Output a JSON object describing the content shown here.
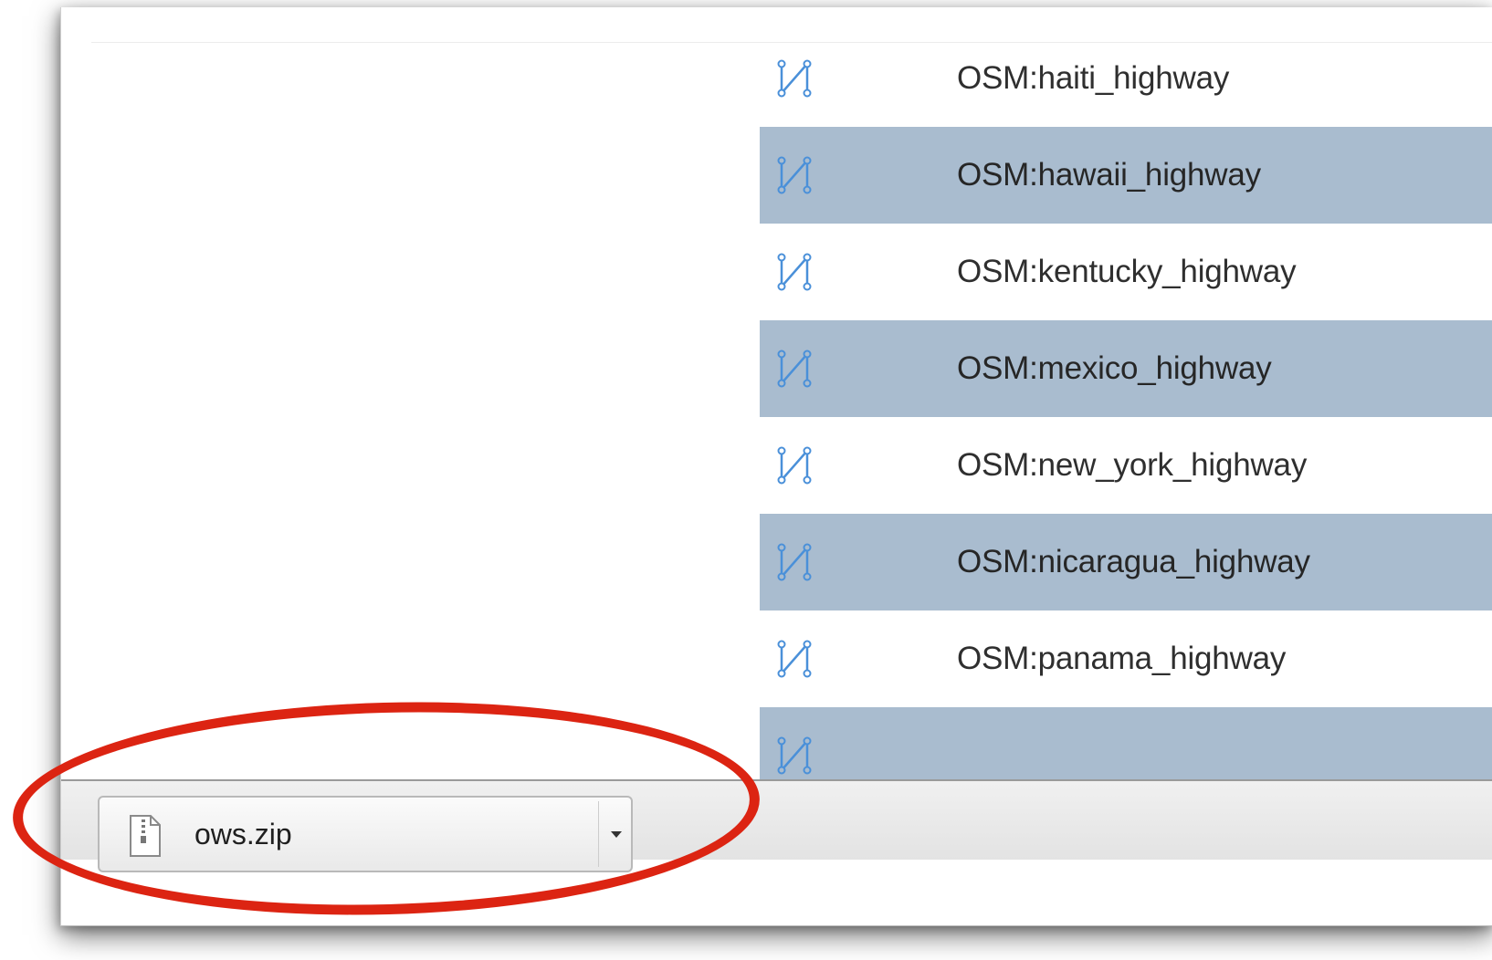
{
  "layers": {
    "items": [
      {
        "name": "OSM:haiti_highway",
        "icon": "line-geometry-icon",
        "shaded": false
      },
      {
        "name": "OSM:hawaii_highway",
        "icon": "line-geometry-icon",
        "shaded": true
      },
      {
        "name": "OSM:kentucky_highway",
        "icon": "line-geometry-icon",
        "shaded": false
      },
      {
        "name": "OSM:mexico_highway",
        "icon": "line-geometry-icon",
        "shaded": true
      },
      {
        "name": "OSM:new_york_highway",
        "icon": "line-geometry-icon",
        "shaded": false
      },
      {
        "name": "OSM:nicaragua_highway",
        "icon": "line-geometry-icon",
        "shaded": true
      },
      {
        "name": "OSM:panama_highway",
        "icon": "line-geometry-icon",
        "shaded": false
      },
      {
        "name": "",
        "icon": "line-geometry-icon",
        "shaded": true
      }
    ]
  },
  "download_shelf": {
    "file_name": "ows.zip",
    "file_icon": "zip-file-icon",
    "menu_icon": "dropdown-arrow-icon"
  },
  "colors": {
    "row_shaded": "#a9bccf",
    "icon_blue": "#4a90d9",
    "annotation_red": "#dc2412"
  }
}
